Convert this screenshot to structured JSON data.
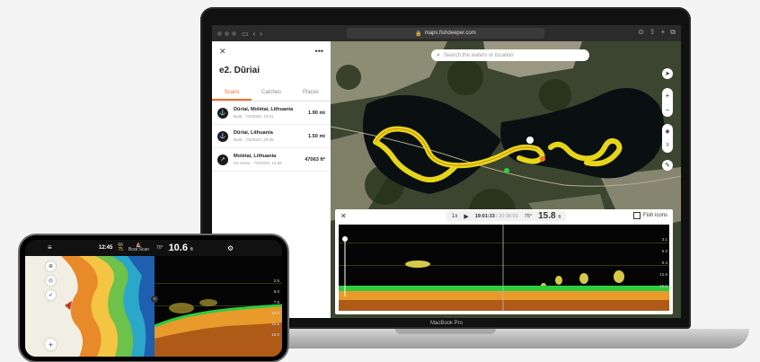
{
  "browser": {
    "url": "maps.fishdeeper.com"
  },
  "sidebar": {
    "title": "e2. Dūriai",
    "tabs": [
      {
        "label": "Scans",
        "active": true
      },
      {
        "label": "Catches",
        "active": false
      },
      {
        "label": "Places",
        "active": false
      }
    ],
    "items": [
      {
        "name": "Dūriai, Molėtai, Lithuania",
        "sub": "Boat · 7/4/2020, 13:01",
        "value": "1.90 mi"
      },
      {
        "name": "Dūriai, Lithuania",
        "sub": "Boat · 7/4/2020, 20:05",
        "value": "1.50 mi"
      },
      {
        "name": "Molėtai, Lithuania",
        "sub": "On shore · 7/4/2020, 12:58",
        "value": "47063 ft²"
      }
    ]
  },
  "map": {
    "search_placeholder": "Search the waters or location"
  },
  "sonar": {
    "speed": "1x",
    "time_current": "19:01:33",
    "time_total": "/ 20:36:01",
    "temperature": "75°",
    "depth": "15.8",
    "depth_unit": "ft",
    "fish_icons_label": "Fish icons",
    "scale": [
      "3.1",
      "6.3",
      "9.4",
      "12.5",
      "15.6"
    ]
  },
  "laptop": {
    "brand_label": "MacBook Pro"
  },
  "phone": {
    "time": "12:45",
    "stat_top": "66",
    "stat_bottom": "75",
    "mode_label": "Boat Scan",
    "temperature": "70°",
    "depth": "10.6",
    "depth_unit": "ft",
    "scale": [
      "2.5",
      "5.0",
      "7.5",
      "10.0",
      "12.5",
      "15.0"
    ]
  },
  "colors": {
    "accent": "#f37021",
    "track": "#f2e01a",
    "sonar_bottom": "#e89a2a"
  }
}
